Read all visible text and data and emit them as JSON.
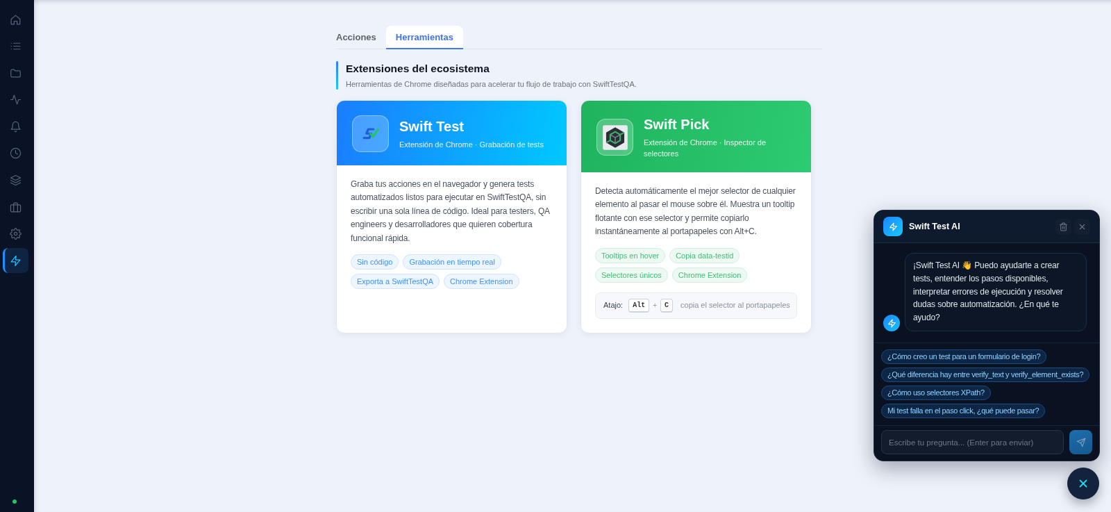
{
  "sidebar": {
    "items": [
      {
        "kind": "home",
        "selected": false
      },
      {
        "kind": "list",
        "selected": false
      },
      {
        "kind": "folder",
        "selected": false
      },
      {
        "kind": "activity",
        "selected": false
      },
      {
        "kind": "bell",
        "selected": false
      },
      {
        "kind": "clock",
        "selected": false
      },
      {
        "kind": "layers",
        "selected": false
      },
      {
        "kind": "briefcase",
        "selected": false
      },
      {
        "kind": "settings",
        "selected": false
      },
      {
        "kind": "bolt",
        "selected": true
      }
    ],
    "status_indicator": {
      "on": true
    }
  },
  "tabs": [
    {
      "label": "Acciones",
      "selected": false
    },
    {
      "label": "Herramientas",
      "selected": true
    }
  ],
  "section": {
    "title": "Extensiones del ecosistema",
    "subtitle": "Herramientas de Chrome diseñadas para acelerar tu flujo de trabajo con SwiftTestQA."
  },
  "cards": [
    {
      "kind": "monogram",
      "color": "#1a7dff",
      "title": "Swift Test",
      "subtitle": "Extensión de Chrome · Grabación de tests",
      "description": "Graba tus acciones en el navegador y genera tests automatizados listos para ejecutar en SwiftTestQA, sin escribir una sola línea de código. Ideal para testers, QA engineers y desarrolladores que quieren cobertura funcional rápida.",
      "tags": [
        "Sin código",
        "Grabación en tiempo real",
        "Exporta a SwiftTestQA",
        "Chrome Extension"
      ]
    },
    {
      "kind": "cube",
      "color": "#1fb35e",
      "title": "Swift Pick",
      "subtitle": "Extensión de Chrome · Inspector de selectores",
      "description": "Detecta automáticamente el mejor selector de cualquier elemento al pasar el mouse sobre él. Muestra un tooltip flotante con ese selector y permite copiarlo instantáneamente al portapapeles con Alt+C.",
      "tags": [
        "Tooltips en hover",
        "Copia data-testid",
        "Selectores únicos",
        "Chrome Extension"
      ],
      "shortcut": {
        "label": "Atajo:",
        "keys": [
          "Alt",
          "C"
        ],
        "separator": "+",
        "hint": "copia el selector al portapapeles"
      }
    }
  ],
  "chat": {
    "open": true,
    "title": "Swift Test AI",
    "messages": [
      {
        "kind": "assistant",
        "text": "¡Swift Test AI 👋 Puedo ayudarte a crear tests, entender los pasos disponibles, interpretar errores de ejecución y resolver dudas sobre automatización. ¿En qué te ayudo?"
      }
    ],
    "suggestions": [
      "¿Cómo creo un test para un formulario de login?",
      "¿Qué diferencia hay entre verify_text y verify_element_exists?",
      "¿Cómo uso selectores XPath?",
      "Mi test falla en el paso click, ¿qué puede pasar?"
    ],
    "input": {
      "placeholder": "Escribe tu pregunta... (Enter para enviar)"
    }
  }
}
